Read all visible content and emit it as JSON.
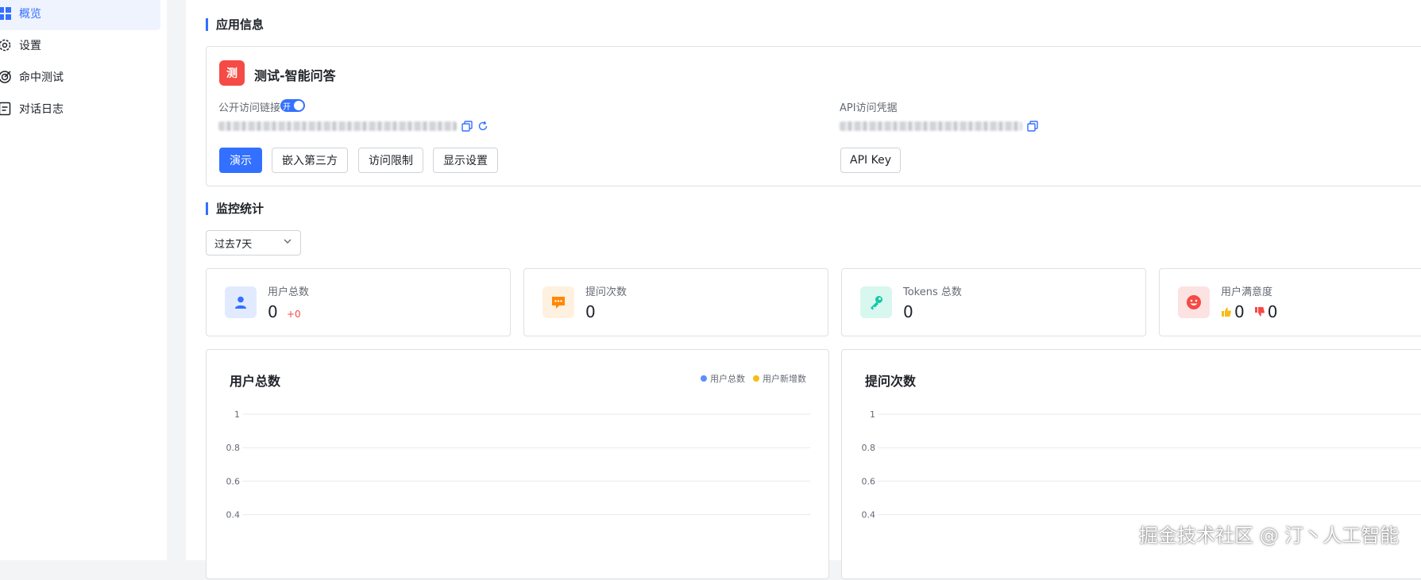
{
  "sidebar": {
    "items": [
      {
        "label": "概览",
        "icon": "grid-icon",
        "active": true
      },
      {
        "label": "设置",
        "icon": "gear-icon",
        "active": false
      },
      {
        "label": "命中测试",
        "icon": "target-icon",
        "active": false
      },
      {
        "label": "对话日志",
        "icon": "document-icon",
        "active": false
      }
    ]
  },
  "app_info": {
    "section_title": "应用信息",
    "avatar_text": "测",
    "app_name": "测试-智能问答",
    "public_link_label": "公开访问链接",
    "toggle_label": "开",
    "api_credential_label": "API访问凭据",
    "buttons": {
      "demo": "演示",
      "embed": "嵌入第三方",
      "access_limit": "访问限制",
      "display_settings": "显示设置",
      "api_key": "API Key"
    }
  },
  "monitor": {
    "section_title": "监控统计",
    "period": "过去7天",
    "stats": [
      {
        "label": "用户总数",
        "value": "0",
        "delta": "+0",
        "icon": "user-icon",
        "color": "#3370ff"
      },
      {
        "label": "提问次数",
        "value": "0",
        "icon": "chat-bubble-icon",
        "color": "#ff8800"
      },
      {
        "label": "Tokens 总数",
        "value": "0",
        "icon": "key-icon",
        "color": "#14c9a6"
      },
      {
        "label": "用户满意度",
        "like": "0",
        "dislike": "0",
        "icon": "smile-icon",
        "color": "#f54a45"
      }
    ]
  },
  "chart_data": [
    {
      "type": "line",
      "title": "用户总数",
      "series": [
        {
          "name": "用户总数",
          "values": [],
          "color": "#5b8ff9"
        },
        {
          "name": "用户新增数",
          "values": [],
          "color": "#f6bd16"
        }
      ],
      "y_ticks": [
        "1",
        "0.8",
        "0.6",
        "0.4"
      ],
      "ylim": [
        0,
        1
      ],
      "grid": true,
      "legend": "top-right"
    },
    {
      "type": "line",
      "title": "提问次数",
      "series": [],
      "y_ticks": [
        "1",
        "0.8",
        "0.6",
        "0.4"
      ],
      "ylim": [
        0,
        1
      ],
      "grid": true
    }
  ],
  "watermark": "掘金技术社区 @ 汀丶人工智能"
}
